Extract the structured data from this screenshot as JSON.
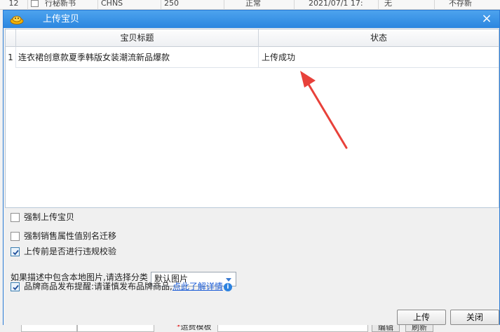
{
  "background": {
    "top_row_cells": [
      "12",
      "行秘新书",
      "CHNS",
      "250",
      "正常",
      "2021/07/1 17:",
      "无",
      "不存新"
    ],
    "bottom_row": {
      "required_mark": "*",
      "freight_label": "运费模板",
      "edit_button": "编辑",
      "refresh_button": "刷新"
    }
  },
  "dialog": {
    "title": "上传宝贝",
    "close_glyph": "×"
  },
  "grid": {
    "columns": [
      "宝贝标题",
      "状态"
    ],
    "rows": [
      {
        "index": "1",
        "title": "连衣裙创意款夏季韩版女装潮流新品爆款",
        "status": "上传成功"
      }
    ]
  },
  "options": {
    "force_upload": {
      "label": "强制上传宝贝",
      "checked": false
    },
    "force_alias_migrate": {
      "label": "强制销售属性值别名迁移",
      "checked": false
    },
    "pre_upload_check": {
      "label": "上传前是否进行违规校验",
      "checked": true
    },
    "category_prompt": "如果描述中包含本地图片,请选择分类",
    "category_select": {
      "value": "默认图片"
    },
    "brand_reminder": {
      "checked": true,
      "label": "品牌商品发布提醒:请谨慎发布品牌商品,",
      "link": "点此了解详情",
      "info_glyph": "i"
    }
  },
  "buttons": {
    "upload": "上传",
    "close": "关闭"
  },
  "colors": {
    "titlebar": "#2b86df",
    "annotation_arrow": "#e8413a",
    "link": "#1a5bd6"
  }
}
